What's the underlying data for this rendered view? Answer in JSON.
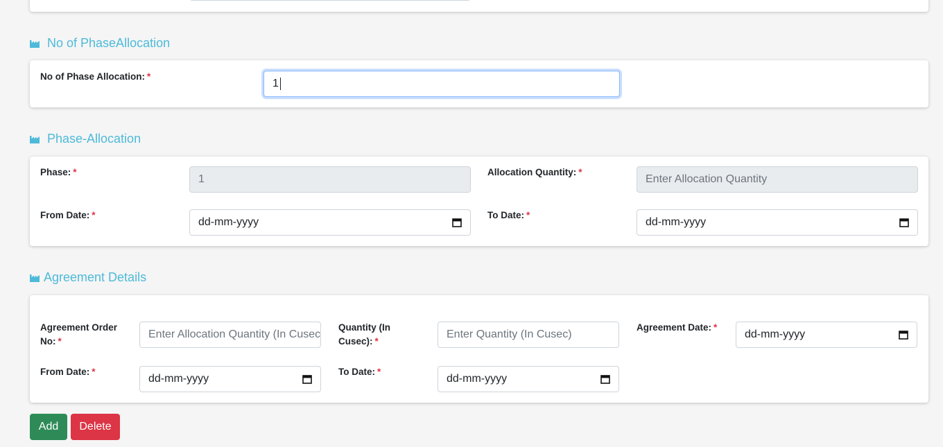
{
  "sections": {
    "phase_count": {
      "title": "No of PhaseAllocation",
      "label": "No of Phase Allocation:",
      "value": "1"
    },
    "phase_allocation": {
      "title": "Phase-Allocation",
      "phase_label": "Phase:",
      "phase_value": "1",
      "allocation_qty_label": "Allocation Quantity:",
      "allocation_qty_placeholder": "Enter Allocation Quantity",
      "from_date_label": "From Date:",
      "from_date_value": "dd-mm-yyyy",
      "to_date_label": "To Date:",
      "to_date_value": "dd-mm-yyyy"
    },
    "agreement": {
      "title": "Agreement Details",
      "order_no_label_1": "Agreement Order",
      "order_no_label_2": "No:",
      "order_no_placeholder": "Enter Allocation Quantity (In Cusec)",
      "quantity_label_1": "Quantity (In",
      "quantity_label_2": "Cusec):",
      "quantity_placeholder": "Enter Quantity (In Cusec)",
      "agreement_date_label": "Agreement Date:",
      "agreement_date_value": "dd-mm-yyyy",
      "from_date_label": "From Date:",
      "from_date_value": "dd-mm-yyyy",
      "to_date_label": "To Date:",
      "to_date_value": "dd-mm-yyyy"
    }
  },
  "required_marker": "*",
  "buttons": {
    "add": "Add",
    "delete": "Delete"
  },
  "icons": {
    "section": "industry-icon",
    "date": "calendar-icon"
  },
  "colors": {
    "section_title": "#4dbad9",
    "required": "#dc3545",
    "add_button": "#2e8b57",
    "delete_button": "#dc3545"
  }
}
